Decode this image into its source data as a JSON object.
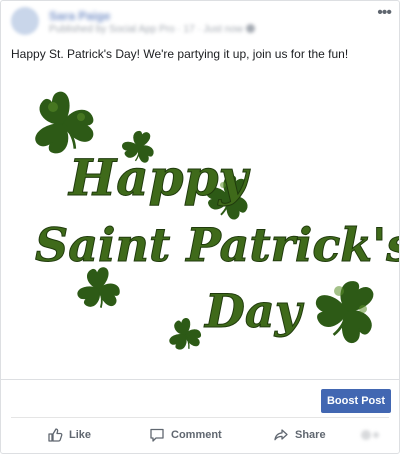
{
  "post": {
    "page_name": "Sara Paige",
    "meta": "Published by Social App Pro · 17 · Just now",
    "more_icon": "ellipsis-icon",
    "text": "Happy St. Patrick's Day! We're partying it up, join us for the fun!"
  },
  "image": {
    "line1": "Happy",
    "line2": "Saint Patrick's",
    "line3": "Day",
    "text_color": "#3f6a1a",
    "shamrock_color": "#2d5a16",
    "shamrock_highlight": "#5b8f2a"
  },
  "boost": {
    "label": "Boost Post",
    "color": "#4267b2"
  },
  "actions": {
    "like": {
      "label": "Like",
      "icon": "thumbs-up-icon"
    },
    "comment": {
      "label": "Comment",
      "icon": "comment-icon"
    },
    "share": {
      "label": "Share",
      "icon": "share-icon"
    }
  }
}
